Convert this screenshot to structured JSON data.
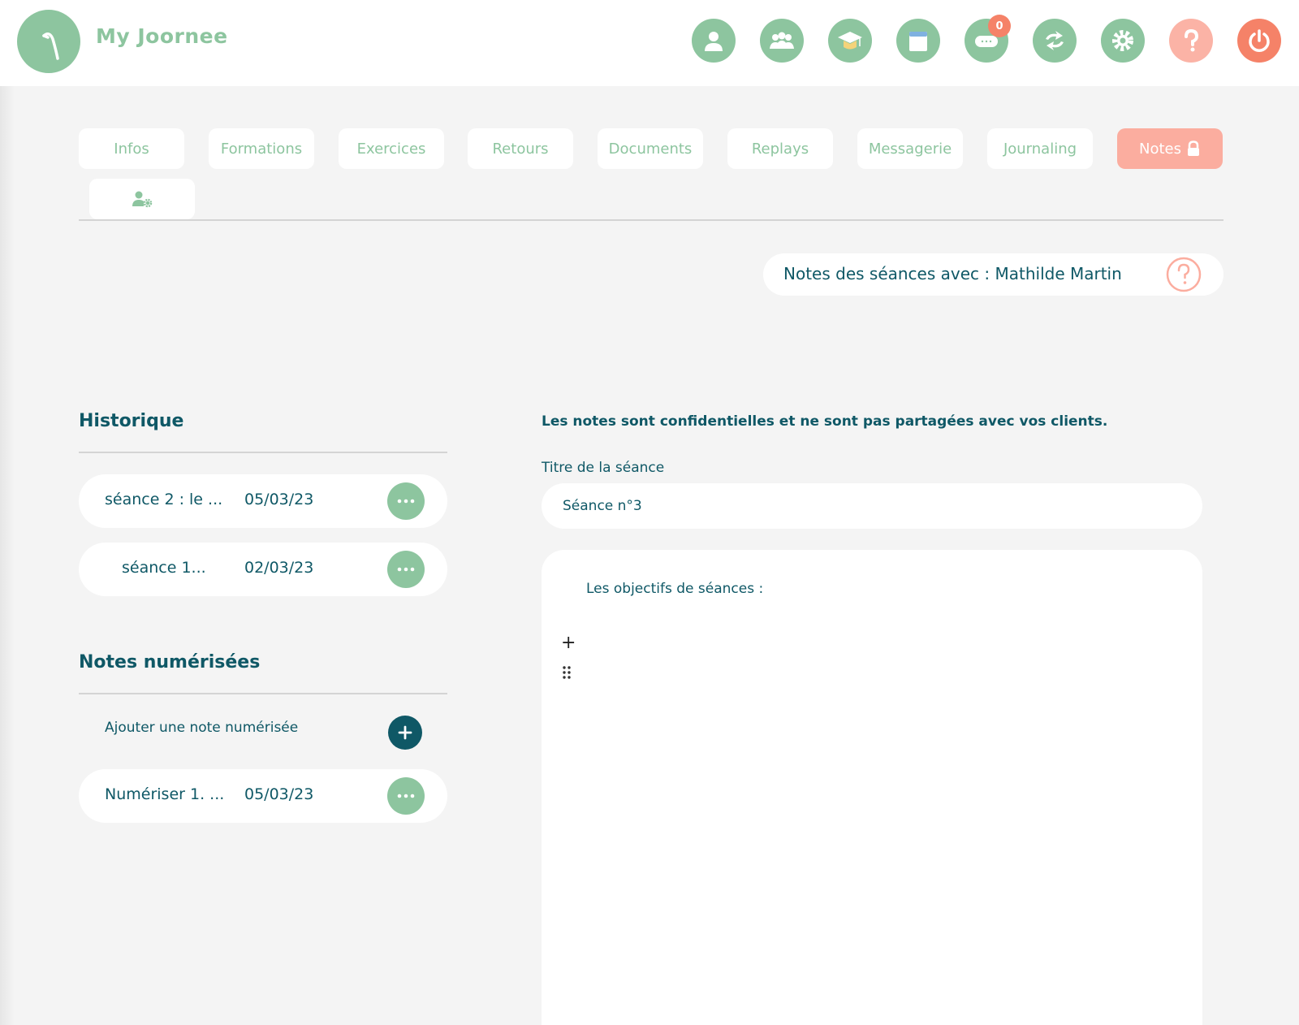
{
  "brand": {
    "name": "My Joornee"
  },
  "header": {
    "icons": [
      "user-icon",
      "group-icon",
      "graduation-icon",
      "calendar-icon",
      "chat-icon",
      "sync-icon",
      "gear-icon",
      "help-icon",
      "power-icon"
    ],
    "chat_badge": "0"
  },
  "tabs": [
    {
      "label": "Infos"
    },
    {
      "label": "Formations"
    },
    {
      "label": "Exercices"
    },
    {
      "label": "Retours"
    },
    {
      "label": "Documents"
    },
    {
      "label": "Replays"
    },
    {
      "label": "Messagerie"
    },
    {
      "label": "Journaling"
    },
    {
      "label": "Notes",
      "active": true
    }
  ],
  "notes_header": {
    "title": "Notes des séances avec : Mathilde Martin"
  },
  "historique": {
    "title": "Historique",
    "items": [
      {
        "title": "séance 2 : le ...",
        "date": "05/03/23"
      },
      {
        "title": "séance 1...",
        "date": "02/03/23"
      }
    ]
  },
  "notes_numerisees": {
    "title": "Notes numérisées",
    "add_label": "Ajouter une note numérisée",
    "items": [
      {
        "title": "Numériser 1. ...",
        "date": "05/03/23"
      }
    ]
  },
  "editor": {
    "confidential_notice": "Les notes sont confidentielles et ne sont pas partagées avec vos clients.",
    "title_label": "Titre de la séance",
    "title_value": "Séance n°3",
    "paragraph": "Les objectifs de séances :",
    "plus": "+"
  },
  "colors": {
    "accent_green": "#8dc59f",
    "dark_teal": "#0f5866",
    "salmon": "#fbad9f",
    "power_orange": "#f58268"
  }
}
